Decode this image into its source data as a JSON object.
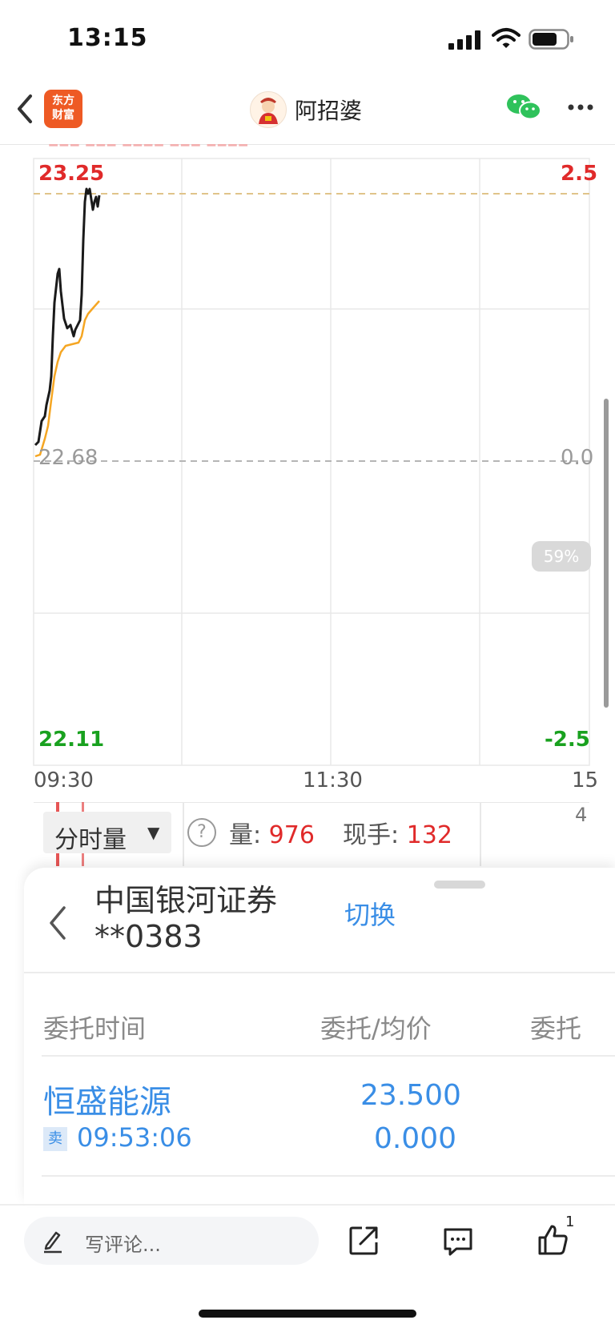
{
  "status_bar": {
    "time": "13:15"
  },
  "nav": {
    "app_logo_line1": "东方",
    "app_logo_line2": "财富",
    "title": "阿招婆"
  },
  "chart": {
    "y_left": {
      "top": "23.25",
      "mid": "22.68",
      "bottom": "22.11"
    },
    "y_right": {
      "top": "2.5",
      "mid": "0.0",
      "bottom": "-2.5"
    },
    "x_labels": {
      "start": "09:30",
      "mid": "11:30",
      "end": "15"
    },
    "scroll_badge": "59%"
  },
  "volume_bar": {
    "selector_label": "分时量",
    "volume_label": "量:",
    "volume_value": "976",
    "hand_label": "现手:",
    "hand_value": "132",
    "right_value": "4"
  },
  "account_panel": {
    "broker": "中国银河证券",
    "account": "**0383",
    "switch_label": "切换"
  },
  "orders_table": {
    "headers": [
      "委托时间",
      "委托/均价",
      "委托"
    ],
    "rows": [
      {
        "stock": "恒盛能源",
        "side": "卖",
        "time": "09:53:06",
        "price": "23.500",
        "avg_price": "0.000"
      }
    ]
  },
  "bottom_bar": {
    "comment_placeholder": "写评论...",
    "like_count": "1"
  },
  "colors": {
    "up_red": "#e02a2a",
    "down_green": "#19a11f",
    "link_blue": "#3a8ee6",
    "avg_line": "#f5a623"
  }
}
